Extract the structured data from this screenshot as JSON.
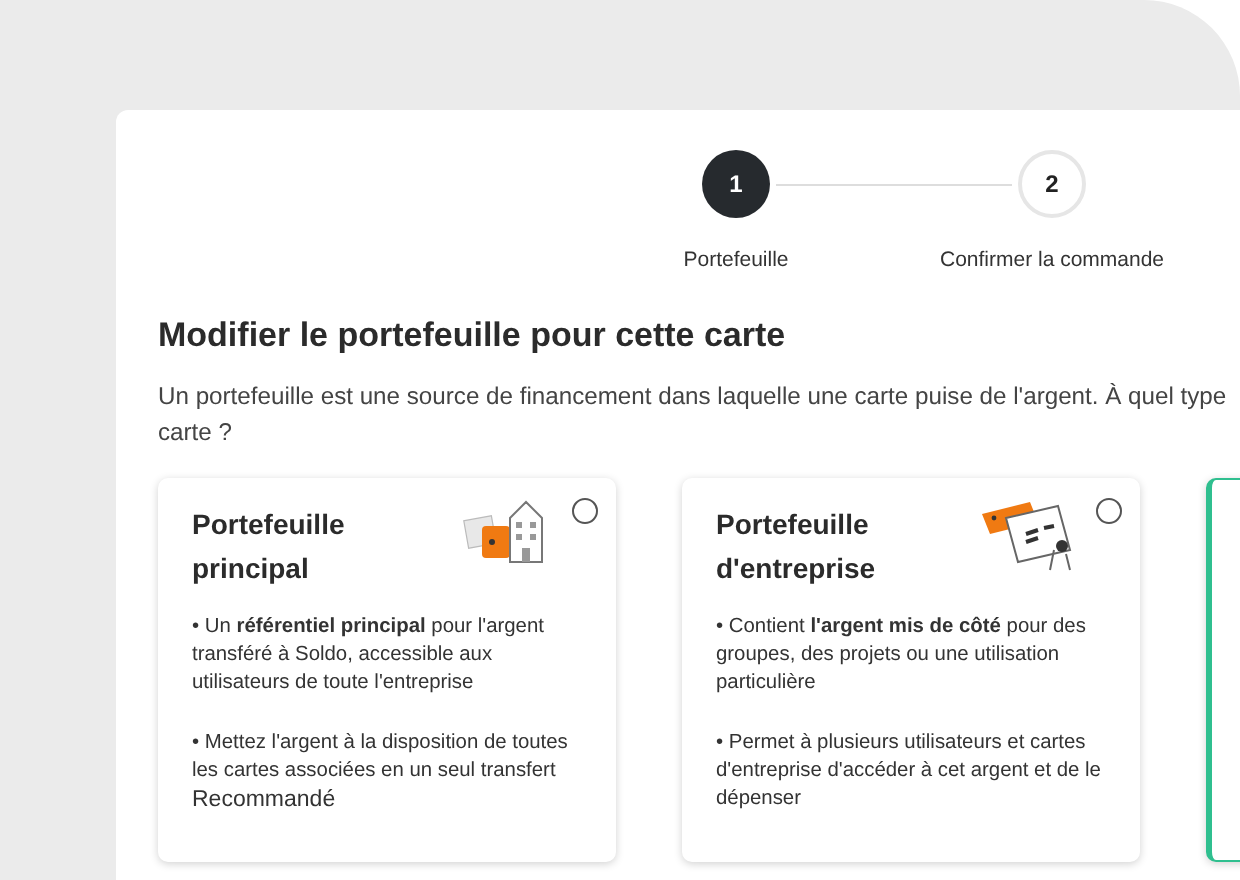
{
  "stepper": [
    {
      "number": "1",
      "label": "Portefeuille",
      "selected": true
    },
    {
      "number": "2",
      "label": "Confirmer la commande",
      "selected": false
    }
  ],
  "heading": "Modifier le portefeuille pour cette carte",
  "description": "Un portefeuille est une source de financement dans laquelle une carte puise de l'argent. À quel type carte ?",
  "cards": [
    {
      "kind": "main",
      "title": "Portefeuille principal",
      "selected": false,
      "bullets": [
        "• Un **référentiel principal** pour l'argent transféré à Soldo, accessible aux utilisateurs de toute l'entreprise",
        "• Mettez l'argent à la disposition de toutes les cartes associées en un seul transfert"
      ],
      "tag": "Recommandé"
    },
    {
      "kind": "company",
      "title": "Portefeuille d'entreprise",
      "selected": false,
      "bullets": [
        "• Contient **l'argent mis de côté** pour des groupes, des projets ou une utilisation particulière",
        "• Permet à plusieurs utilisateurs et cartes d'entreprise d'accéder à cet argent et de le dépenser"
      ]
    },
    {
      "selected": true
    }
  ]
}
